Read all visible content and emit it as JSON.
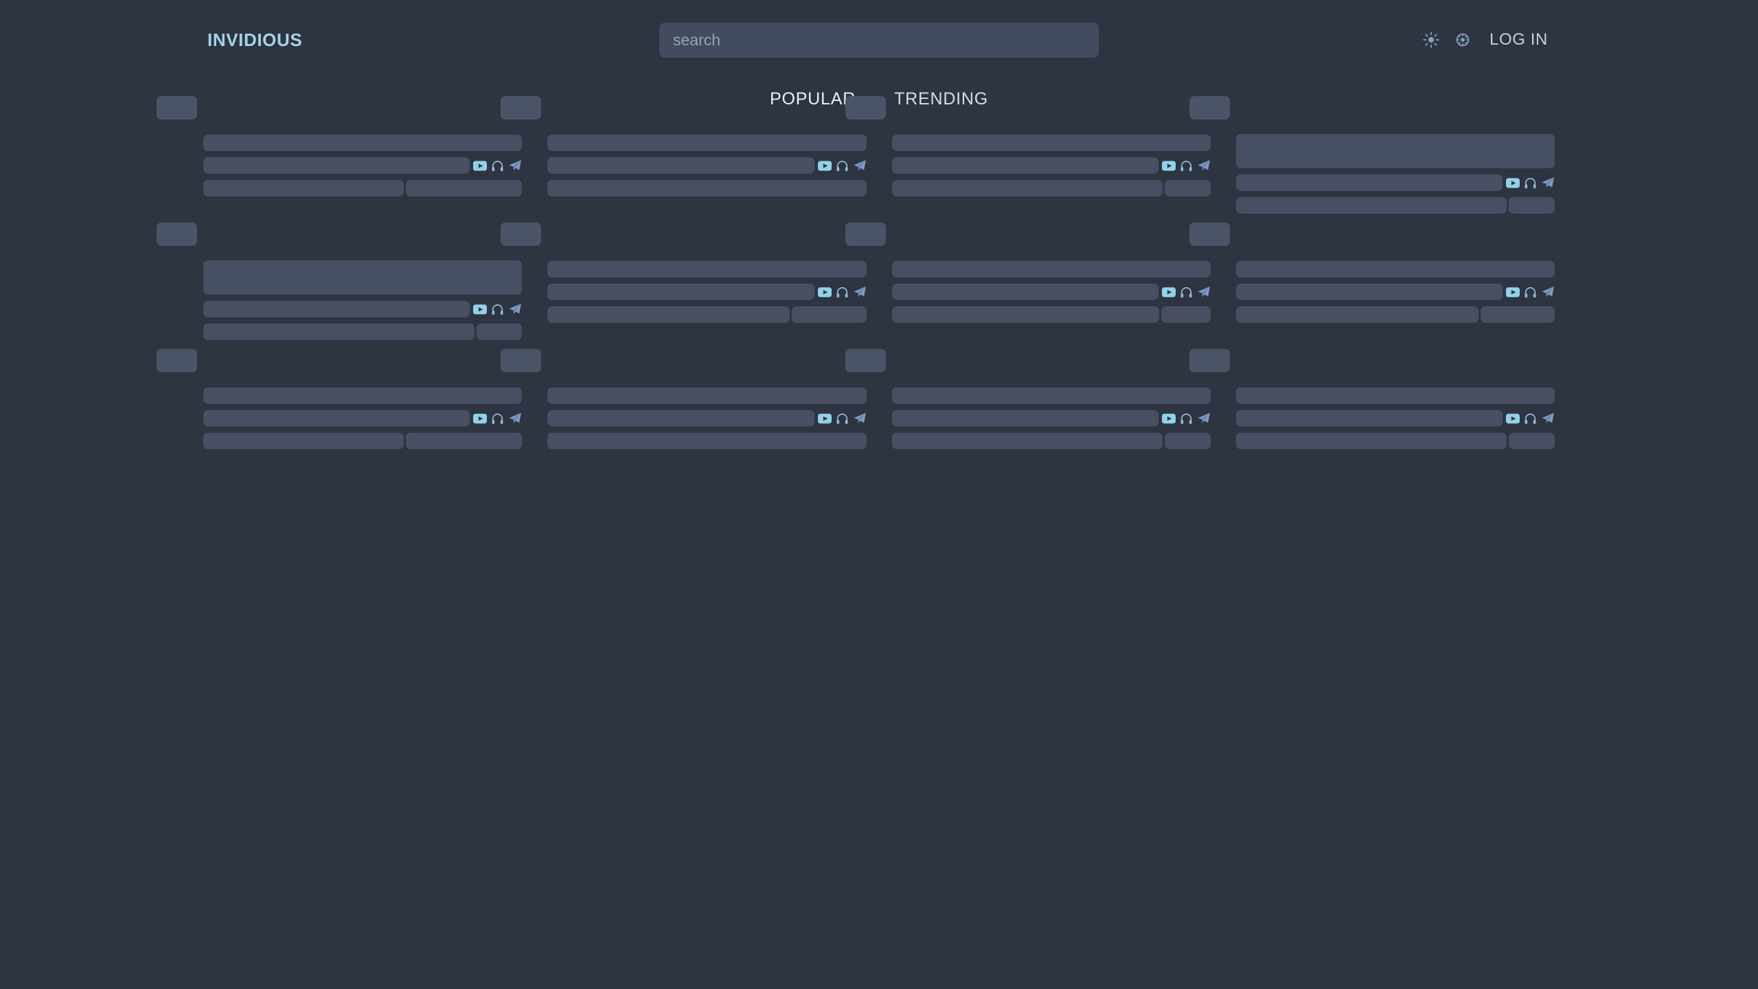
{
  "header": {
    "brand": "INVIDIOUS",
    "search": {
      "placeholder": "search",
      "value": ""
    },
    "theme_toggle_icon": "sun-icon",
    "preferences_icon": "gear-icon",
    "login_label": "LOG IN"
  },
  "tabs": [
    {
      "label": "POPULAR",
      "active": true
    },
    {
      "label": "TRENDING",
      "active": false
    }
  ],
  "colors": {
    "page_background": "#2e3440",
    "thumbnail_placeholder": "#282d38",
    "skeleton": "#474f63",
    "search_field": "#434c5e",
    "brand_accent": "#a3d5e8",
    "icon_accent": "#8fbcdb",
    "text": "#d8dee9"
  },
  "video_icons": [
    {
      "name": "youtube-icon",
      "title": "Watch on YouTube"
    },
    {
      "name": "headphones-icon",
      "title": "Audio mode"
    },
    {
      "name": "paper-plane-icon",
      "title": "Share"
    }
  ],
  "grid": {
    "columns": 4,
    "state": "loading-skeleton",
    "cards": [
      {
        "title_lines": 1,
        "views_split": 0.63,
        "icons": true
      },
      {
        "title_lines": 1,
        "views_split": 1.0,
        "icons": true
      },
      {
        "title_lines": 1,
        "views_split": 0.85,
        "icons": true
      },
      {
        "title_lines": 2,
        "views_split": 0.85,
        "icons": true
      },
      {
        "title_lines": 2,
        "views_split": 0.85,
        "icons": true
      },
      {
        "title_lines": 1,
        "views_split": 0.76,
        "icons": true
      },
      {
        "title_lines": 1,
        "views_split": 0.84,
        "icons": true
      },
      {
        "title_lines": 1,
        "views_split": 0.76,
        "icons": true
      },
      {
        "title_lines": 1,
        "views_split": 0.63,
        "icons": true
      },
      {
        "title_lines": 1,
        "views_split": 1.0,
        "icons": true
      },
      {
        "title_lines": 1,
        "views_split": 0.85,
        "icons": true
      },
      {
        "title_lines": 1,
        "views_split": 0.85,
        "icons": true
      }
    ]
  }
}
